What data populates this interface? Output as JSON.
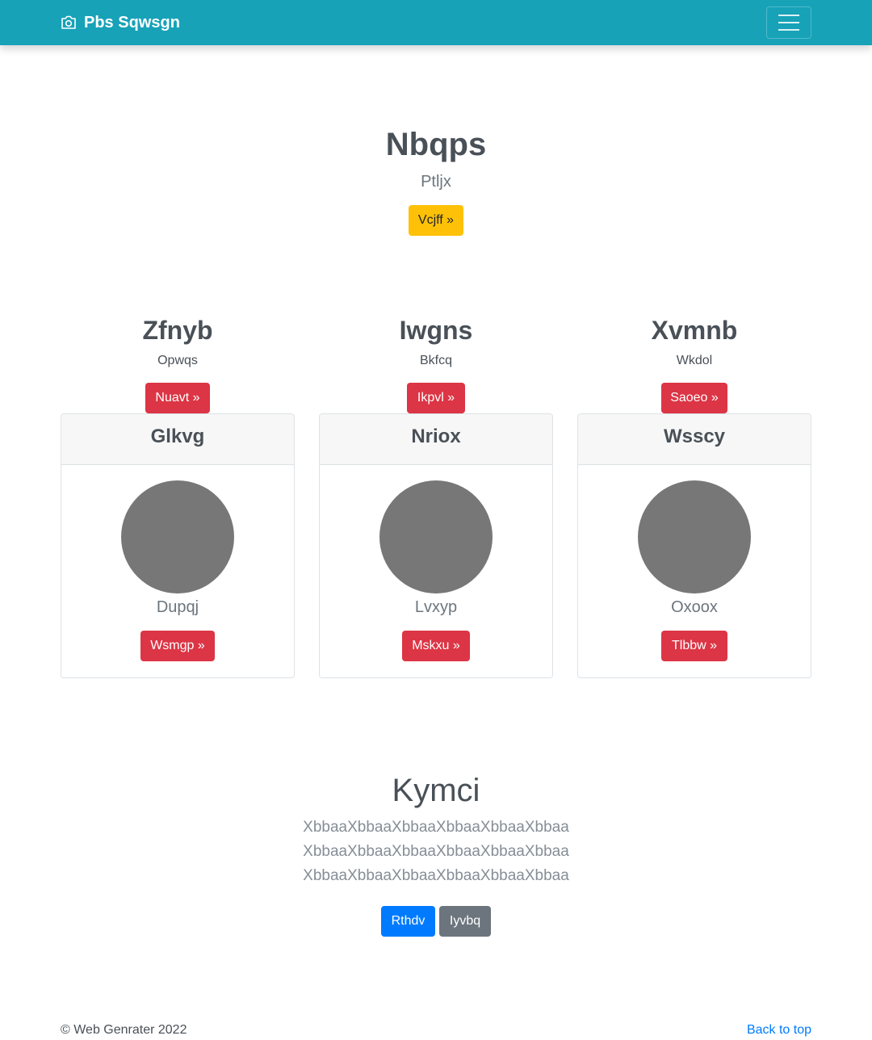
{
  "navbar": {
    "brand": "Pbs Sqwsgn",
    "brand_icon": "camera-icon",
    "toggler_icon": "hamburger-menu-icon",
    "bg_color": "#17a2b8"
  },
  "hero": {
    "title": "Nbqps",
    "subtitle": "Ptljx",
    "button": "Vcjff »"
  },
  "features": [
    {
      "title": "Zfnyb",
      "subtitle": "Opwqs",
      "button": "Nuavt »"
    },
    {
      "title": "Iwgns",
      "subtitle": "Bkfcq",
      "button": "Ikpvl »"
    },
    {
      "title": "Xvmnb",
      "subtitle": "Wkdol",
      "button": "Saoeo »"
    }
  ],
  "cards": [
    {
      "header": "Glkvg",
      "text": "Dupqj",
      "button": "Wsmgp »"
    },
    {
      "header": "Nriox",
      "text": "Lvxyp",
      "button": "Mskxu »"
    },
    {
      "header": "Wsscy",
      "text": "Oxoox",
      "button": "Tlbbw »"
    }
  ],
  "about": {
    "title": "Kymci",
    "lines": [
      "XbbaaXbbaaXbbaaXbbaaXbbaaXbbaa",
      "XbbaaXbbaaXbbaaXbbaaXbbaaXbbaa",
      "XbbaaXbbaaXbbaaXbbaaXbbaaXbbaa"
    ],
    "primary_button": "Rthdv",
    "secondary_button": "Iyvbq"
  },
  "footer": {
    "copyright": "© Web Genrater 2022",
    "back_to_top": "Back to top"
  },
  "colors": {
    "danger": "#dc3545",
    "warning": "#ffc107",
    "primary": "#007bff",
    "secondary": "#6c757d"
  }
}
